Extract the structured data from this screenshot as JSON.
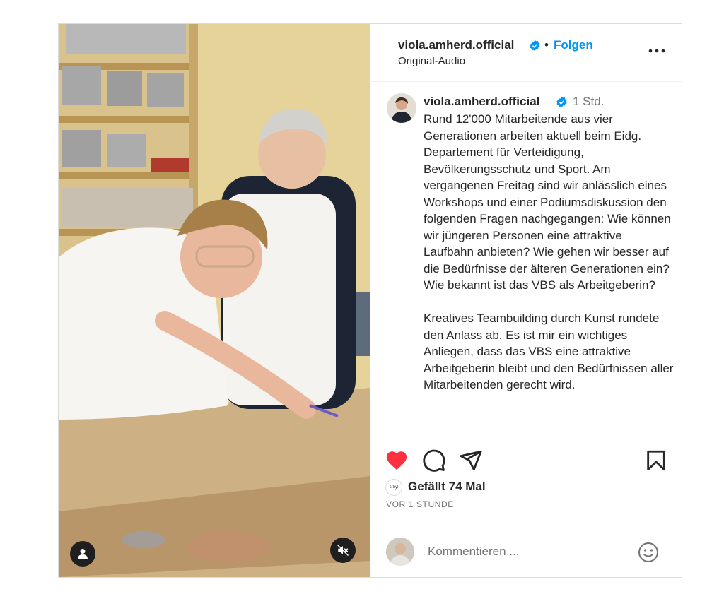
{
  "post": {
    "username": "viola.amherd.official",
    "separator": "•",
    "follow_label": "Folgen",
    "audio_label": "Original-Audio",
    "caption": {
      "username": "viola.amherd.official",
      "time_ago": "1 Std.",
      "text": "Rund 12'000 Mitarbeitende aus vier Generationen arbeiten aktuell beim Eidg. Departement für Verteidigung, Bevölkerungsschutz und Sport. Am vergangenen Freitag sind wir anlässlich eines Workshops und einer Podiumsdiskussion den folgenden Fragen nachgegangen: Wie können wir jüngeren Personen eine attraktive Laufbahn anbieten? Wie gehen wir besser auf die Bedürfnisse der älteren Generationen ein? Wie bekannt ist das VBS als Arbeitgeberin?\n\nKreatives Teambuilding durch Kunst rundete den Anlass ab. Es ist mir ein wichtiges Anliegen, dass das VBS eine attraktive Arbeitgeberin bleibt und den Bedürfnissen aller Mitarbeitenden gerecht wird."
    },
    "likes_text": "Gefällt 74 Mal",
    "liker_avatar_text": "cr8yl",
    "timestamp": "VOR 1 STUNDE",
    "comment_placeholder": "Kommentieren ...",
    "liked": true
  },
  "icons": {
    "verified": "verified-badge-icon",
    "more": "more-options-icon",
    "like": "heart-icon",
    "comment": "comment-icon",
    "share": "paper-plane-icon",
    "save": "bookmark-icon",
    "emoji": "smiley-icon",
    "user_tag": "user-icon",
    "mute": "speaker-muted-icon"
  },
  "colors": {
    "accent": "#0095f6",
    "like": "#ff3040",
    "verified": "#0095f6",
    "text": "#262626",
    "secondary_text": "#737373"
  }
}
